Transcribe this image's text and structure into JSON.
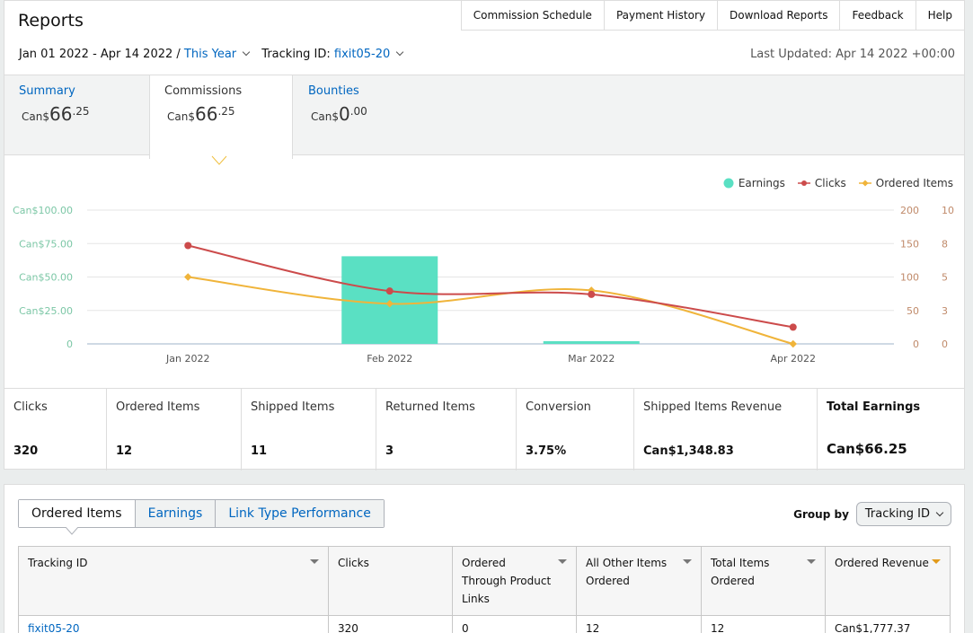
{
  "header": {
    "title": "Reports",
    "nav": [
      "Commission Schedule",
      "Payment History",
      "Download Reports",
      "Feedback",
      "Help"
    ],
    "date_range": "Jan 01 2022 - Apr 14 2022 /",
    "date_preset": "This Year",
    "tracking_label": "Tracking ID:",
    "tracking_value": "fixit05-20",
    "last_updated": "Last Updated: Apr 14 2022 +00:00"
  },
  "tabs": [
    {
      "label": "Summary",
      "currency": "Can$",
      "whole": "66",
      "cents": ".25"
    },
    {
      "label": "Commissions",
      "currency": "Can$",
      "whole": "66",
      "cents": ".25"
    },
    {
      "label": "Bounties",
      "currency": "Can$",
      "whole": "0",
      "cents": ".00"
    }
  ],
  "legend": [
    "Earnings",
    "Clicks",
    "Ordered Items"
  ],
  "colors": {
    "earnings": "#5ae0c3",
    "clicks": "#cc4b4b",
    "ordered": "#f0b43a",
    "link": "#0066c0",
    "sort_active": "#e29a1a"
  },
  "chart_data": {
    "type": "bar",
    "categories": [
      "Jan 2022",
      "Feb 2022",
      "Mar 2022",
      "Apr 2022"
    ],
    "y_left_ticks": [
      "Can$100.00",
      "Can$75.00",
      "Can$50.00",
      "Can$25.00",
      "0"
    ],
    "y_right1_ticks": [
      "200",
      "150",
      "100",
      "50",
      "0"
    ],
    "y_right2_ticks": [
      "10",
      "8",
      "5",
      "3",
      "0"
    ],
    "ylim_left": [
      0,
      100
    ],
    "ylim_clicks": [
      0,
      200
    ],
    "ylim_ordered": [
      0,
      10
    ],
    "series": [
      {
        "name": "Earnings",
        "type": "bar",
        "values": [
          0,
          65.5,
          2,
          0
        ]
      },
      {
        "name": "Clicks",
        "type": "line",
        "values": [
          147,
          79,
          74,
          25
        ]
      },
      {
        "name": "Ordered Items",
        "type": "line",
        "values": [
          5,
          3,
          4,
          0
        ]
      }
    ]
  },
  "stats": [
    {
      "label": "Clicks",
      "value": "320"
    },
    {
      "label": "Ordered Items",
      "value": "12"
    },
    {
      "label": "Shipped Items",
      "value": "11"
    },
    {
      "label": "Returned Items",
      "value": "3"
    },
    {
      "label": "Conversion",
      "value": "3.75%"
    },
    {
      "label": "Shipped Items Revenue",
      "value": "Can$1,348.83"
    },
    {
      "label": "Total Earnings",
      "value": "Can$66.25"
    }
  ],
  "bottom": {
    "tabs": [
      "Ordered Items",
      "Earnings",
      "Link Type Performance"
    ],
    "group_by_label": "Group by",
    "group_by_value": "Tracking ID",
    "columns": [
      "Tracking ID",
      "Clicks",
      "Ordered Through Product Links",
      "All Other Items Ordered",
      "Total Items Ordered",
      "Ordered Revenue"
    ],
    "rows": [
      [
        "fixit05-20",
        "320",
        "0",
        "12",
        "12",
        "Can$1,777.37"
      ]
    ]
  }
}
